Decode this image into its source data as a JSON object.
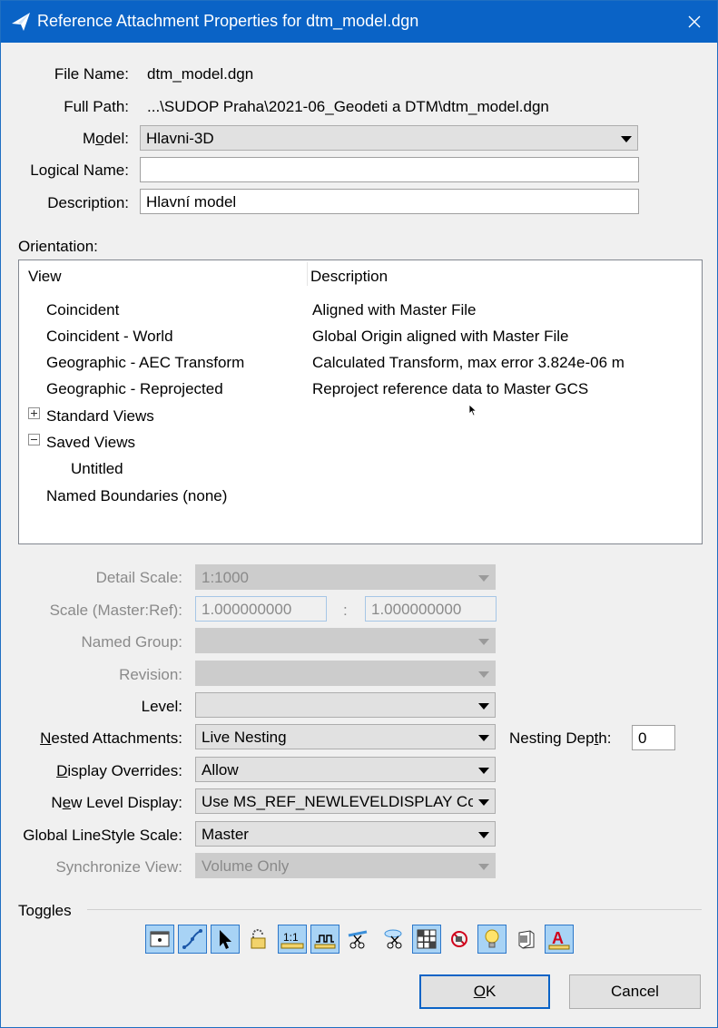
{
  "window": {
    "title": "Reference Attachment Properties for dtm_model.dgn"
  },
  "fields": {
    "file_name_label": "File Name:",
    "file_name_value": "dtm_model.dgn",
    "full_path_label": "Full Path:",
    "full_path_value": "...\\SUDOP Praha\\2021-06_Geodeti a DTM\\dtm_model.dgn",
    "model_label_pre": "M",
    "model_label_u": "o",
    "model_label_post": "del:",
    "model_value": "Hlavni-3D",
    "logical_name_label_pre": "Lo",
    "logical_name_label_u": "g",
    "logical_name_label_post": "ical Name:",
    "logical_name_value": "",
    "description_label": "Description:",
    "description_value": "Hlavní model"
  },
  "orientation": {
    "label": "Orientation:",
    "col_view": "View",
    "col_description": "Description",
    "rows": [
      {
        "view": "Coincident",
        "description": "Aligned with Master File"
      },
      {
        "view": "Coincident - World",
        "description": "Global Origin aligned with Master File"
      },
      {
        "view": "Geographic - AEC Transform",
        "description": "Calculated Transform, max error 3.824e-06 m"
      },
      {
        "view": "Geographic - Reprojected",
        "description": "Reproject reference data to Master GCS"
      },
      {
        "view": "Standard Views",
        "description": ""
      },
      {
        "view": "Saved Views",
        "description": ""
      },
      {
        "view": "Untitled",
        "description": ""
      },
      {
        "view": "Named Boundaries (none)",
        "description": ""
      }
    ]
  },
  "settings": {
    "detail_scale_label": "Detail Scale:",
    "detail_scale_value": "1:1000",
    "scale_label": "Scale (Master:Ref):",
    "scale_master": "1.000000000",
    "scale_sep": ":",
    "scale_ref": "1.000000000",
    "named_group_label": "Named Group:",
    "named_group_value": "",
    "revision_label": "Revision:",
    "revision_value": "",
    "level_label": "Level:",
    "level_value": "",
    "nested_label_u": "N",
    "nested_label_post": "ested Attachments:",
    "nested_value": "Live Nesting",
    "nesting_depth_label_pre": "Nesting Dep",
    "nesting_depth_label_u": "t",
    "nesting_depth_label_post": "h:",
    "nesting_depth_value": "0",
    "display_overrides_label_u": "D",
    "display_overrides_label_post": "isplay Overrides:",
    "display_overrides_value": "Allow",
    "new_level_label_pre": "N",
    "new_level_label_u": "e",
    "new_level_label_post": "w Level Display:",
    "new_level_value": "Use MS_REF_NEWLEVELDISPLAY Config",
    "linestyle_label": "Global LineStyle Scale:",
    "linestyle_value": "Master",
    "sync_view_label": "Synchronize View:",
    "sync_view_value": "Volume Only"
  },
  "toggles": {
    "label": "Toggles",
    "items": [
      {
        "name": "display-toggle-icon",
        "on": true
      },
      {
        "name": "snap-toggle-icon",
        "on": true
      },
      {
        "name": "locate-toggle-icon",
        "on": true
      },
      {
        "name": "lock-toggle-icon",
        "on": false
      },
      {
        "name": "true-scale-toggle-icon",
        "on": true
      },
      {
        "name": "scale-linestyles-toggle-icon",
        "on": true
      },
      {
        "name": "ignore-when-nesting-toggle-icon",
        "on": false
      },
      {
        "name": "clip-back-toggle-icon",
        "on": false
      },
      {
        "name": "raster-toggle-icon",
        "on": true
      },
      {
        "name": "treat-as-element-toggle-icon",
        "on": false
      },
      {
        "name": "use-lights-toggle-icon",
        "on": true
      },
      {
        "name": "display-raster-refs-toggle-icon",
        "on": false
      },
      {
        "name": "annotation-scale-toggle-icon",
        "on": true
      }
    ]
  },
  "buttons": {
    "ok_u": "O",
    "ok_post": "K",
    "cancel": "Cancel"
  },
  "colors": {
    "titlebar": "#0a63c6",
    "toggle_on_bg": "#a8d3f5",
    "toggle_on_border": "#2c77c9"
  }
}
